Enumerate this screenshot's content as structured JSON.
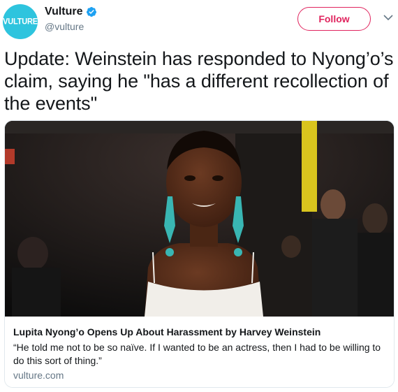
{
  "account": {
    "avatar_text": "VULTURE",
    "display_name": "Vulture",
    "handle": "@vulture",
    "verified": true,
    "avatar_color": "#2ec4de"
  },
  "actions": {
    "follow_label": "Follow",
    "accent_color": "#e0245e"
  },
  "tweet": {
    "text": "Update: Weinstein has responded to Nyong’o’s claim, saying he \"has a different recollection of the events\""
  },
  "card": {
    "title": "Lupita Nyong’o Opens Up About Harassment by Harvey Weinstein",
    "description": "“He told me not to be so naïve. If I wanted to be an actress, then I had to be willing to do this sort of thing.”",
    "domain": "vulture.com"
  },
  "icons": {
    "verified": "verified-badge-icon",
    "caret": "chevron-down-icon"
  }
}
